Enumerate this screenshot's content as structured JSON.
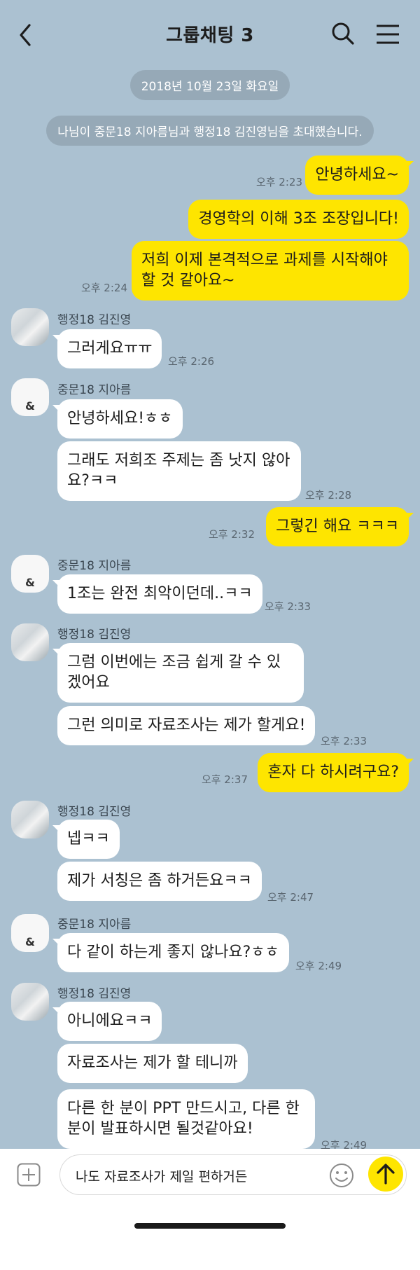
{
  "header": {
    "title": "그룹채팅 3"
  },
  "date_divider": "2018년 10월 23일 화요일",
  "system_message": "나님이 중문18 지아름님과 행정18 김진영님을 초대했습니다.",
  "users": {
    "kim": "행정18 김진영",
    "ji": "중문18 지아름"
  },
  "messages": [
    {
      "text": "안녕하세요~"
    },
    {
      "text": "경영학의 이해 3조 조장입니다!"
    },
    {
      "text": "저희 이제 본격적으로 과제를 시작해야\n할 것 같아요~"
    },
    {
      "text": "그러게요ㅠㅠ"
    },
    {
      "text": "안녕하세요!ㅎㅎ"
    },
    {
      "text": "그래도 저희조 주제는 좀 낫지 않아\n요?ㅋㅋ"
    },
    {
      "text": "그렇긴 해요 ㅋㅋㅋ"
    },
    {
      "text": "1조는 완전 최악이던데..ㅋㅋ"
    },
    {
      "text": "그럼 이번에는 조금 쉽게 갈 수 있\n겠어요"
    },
    {
      "text": "그런 의미로 자료조사는 제가 할게요!"
    },
    {
      "text": "혼자 다 하시려구요?"
    },
    {
      "text": "넵ㅋㅋ"
    },
    {
      "text": "제가 서칭은 좀 하거든요ㅋㅋ"
    },
    {
      "text": "다 같이 하는게 좋지 않나요?ㅎㅎ"
    },
    {
      "text": "아니에요ㅋㅋ"
    },
    {
      "text": "자료조사는 제가 할 테니까"
    },
    {
      "text": "다른 한 분이 PPT 만드시고, 다른 한\n분이 발표하시면 될것같아요!"
    }
  ],
  "times": {
    "t223": "오후 2:23",
    "t224": "오후 2:24",
    "t226": "오후 2:26",
    "t228": "오후 2:28",
    "t232": "오후 2:32",
    "t233a": "오후 2:33",
    "t233b": "오후 2:33",
    "t237": "오후 2:37",
    "t247": "오후 2:47",
    "t249a": "오후 2:49",
    "t249b": "오후 2:49"
  },
  "input": {
    "value": "나도 자료조사가 제일 편하거든"
  },
  "colors": {
    "background": "#abc1d1",
    "my_bubble": "#fee500",
    "other_bubble": "#ffffff"
  }
}
